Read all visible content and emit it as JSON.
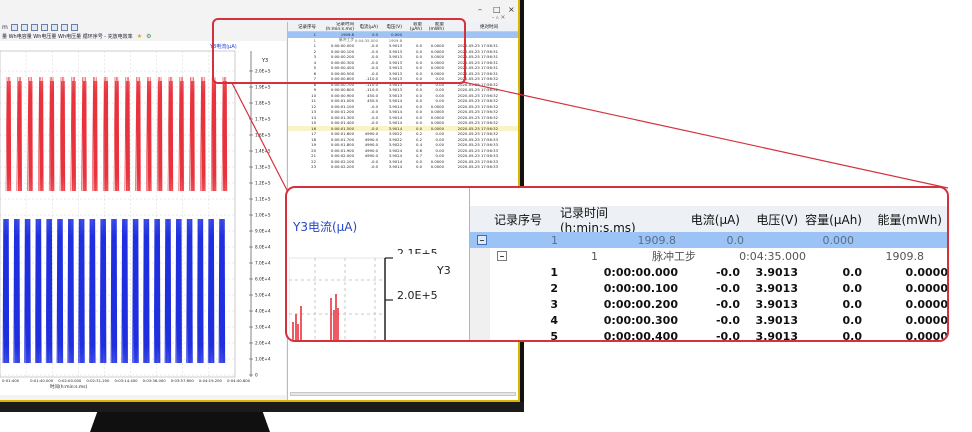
{
  "window": {
    "minimize": "–",
    "maximize": "□",
    "close": "×",
    "restore": "- ₀ ×"
  },
  "toolbar": {
    "buttons": [
      "folder-open",
      "save",
      "chart",
      "table",
      "zoom",
      "export"
    ],
    "row2_text": "量 Wh电容量 Wh电压量 Wh电压量   循环序号 - 充放电效率",
    "star_icon": "★",
    "gear_icon": "⚙"
  },
  "chart": {
    "y_title": "Y3电流(μA)",
    "y_label": "Y3",
    "x_title": "时间(h:min:s.ms)",
    "y_ticks": [
      "2.0E+5",
      "1.9E+5",
      "1.8E+5",
      "1.7E+5",
      "1.6E+5",
      "1.4E+5",
      "1.3E+5",
      "1.2E+5",
      "1.1E+5",
      "1.0E+5",
      "9.0E+4",
      "8.0E+4",
      "7.0E+4",
      "6.0E+4",
      "5.0E+4",
      "4.0E+4",
      "3.0E+4",
      "2.0E+4",
      "1.0E+4",
      "0"
    ],
    "x_ticks": [
      "0:01:400",
      "0:01:40.000",
      "0:02:00.000",
      "0:02:31.200",
      "0:03:14.400",
      "0:03:36.000",
      "0:03:57.600",
      "0:04:19.200",
      "0:04:40.800"
    ],
    "red_color": "#e8323c",
    "blue_color": "#1f2fe0"
  },
  "table": {
    "headers": [
      "记录序号",
      "记录时间(h:min:s.ms)",
      "电流(μA)",
      "电压(V)",
      "容量(μAh)",
      "能量(mWh)",
      "绝对时间"
    ],
    "summary_row": [
      "1",
      "1909.8",
      "0.0",
      "0.000",
      ""
    ],
    "step_row": [
      "1",
      "脉冲工步",
      "0:04:35.000",
      "1909.8"
    ],
    "rows": [
      [
        "1",
        "0:00:00.000",
        "-0.0",
        "3.9013",
        "0.0",
        "0.0000",
        "2020-05-25 17:56:31"
      ],
      [
        "2",
        "0:00:00.100",
        "-0.0",
        "3.9013",
        "0.0",
        "0.0000",
        "2020-05-25 17:56:31"
      ],
      [
        "3",
        "0:00:00.200",
        "-0.0",
        "3.9013",
        "0.0",
        "0.0000",
        "2020-05-25 17:56:31"
      ],
      [
        "4",
        "0:00:00.300",
        "-0.0",
        "3.9013",
        "0.0",
        "0.0000",
        "2020-05-25 17:56:31"
      ],
      [
        "5",
        "0:00:00.400",
        "-0.0",
        "3.9013",
        "0.0",
        "0.0000",
        "2020-05-25 17:56:31"
      ],
      [
        "6",
        "0:00:00.500",
        "-0.0",
        "3.9013",
        "0.0",
        "0.0000",
        "2020-05-25 17:56:31"
      ],
      [
        "7",
        "0:00:00.600",
        "-110.0",
        "3.9013",
        "0.0",
        "0.00",
        "2020-05-25 17:56:32"
      ],
      [
        "8",
        "0:00:00.700",
        "-110.0",
        "3.9013",
        "0.0",
        "0.00",
        "2020-05-25 17:56:32"
      ],
      [
        "9",
        "0:00:00.800",
        "-110.0",
        "3.9013",
        "0.0",
        "0.00",
        "2020-05-25 17:56:32"
      ],
      [
        "10",
        "0:00:00.900",
        "450.0",
        "3.9013",
        "0.0",
        "0.00",
        "2020-05-25 17:56:32"
      ],
      [
        "11",
        "0:00:01.000",
        "450.0",
        "3.9014",
        "0.0",
        "0.00",
        "2020-05-25 17:56:32"
      ],
      [
        "12",
        "0:00:01.100",
        "-0.0",
        "3.9014",
        "0.0",
        "0.0000",
        "2020-05-25 17:56:32"
      ],
      [
        "13",
        "0:00:01.200",
        "-0.0",
        "3.9014",
        "0.0",
        "0.0000",
        "2020-05-25 17:56:32"
      ],
      [
        "14",
        "0:00:01.300",
        "-0.0",
        "3.9014",
        "0.0",
        "0.0000",
        "2020-05-25 17:56:32"
      ],
      [
        "15",
        "0:00:01.400",
        "-0.0",
        "3.9014",
        "0.0",
        "0.0000",
        "2020-05-25 17:56:32"
      ],
      [
        "16",
        "0:00:01.500",
        "-0.0",
        "3.9014",
        "0.0",
        "0.0000",
        "2020-05-25 17:56:32"
      ],
      [
        "17",
        "0:00:01.600",
        "4990.0",
        "3.9022",
        "0.2",
        "0.00",
        "2020-05-25 17:56:32"
      ],
      [
        "18",
        "0:00:01.700",
        "4990.0",
        "3.9022",
        "0.2",
        "0.00",
        "2020-05-25 17:56:33"
      ],
      [
        "19",
        "0:00:01.800",
        "4990.0",
        "3.9022",
        "0.4",
        "0.00",
        "2020-05-25 17:56:33"
      ],
      [
        "20",
        "0:00:01.900",
        "4990.0",
        "3.9024",
        "0.6",
        "0.00",
        "2020-05-25 17:56:33"
      ],
      [
        "21",
        "0:00:02.000",
        "4990.0",
        "3.9024",
        "0.7",
        "0.00",
        "2020-05-25 17:56:33"
      ],
      [
        "22",
        "0:00:02.100",
        "-0.0",
        "3.9014",
        "0.0",
        "0.0000",
        "2020-05-25 17:56:33"
      ],
      [
        "23",
        "0:00:02.200",
        "-0.0",
        "3.9014",
        "0.0",
        "0.0000",
        "2020-05-25 17:56:33"
      ]
    ],
    "bottom_rows": [
      [
        "51",
        "0:00:05.000",
        "35000.0",
        "3.9088",
        "10.4",
        "0.04",
        "2020-05-25 17:56:36"
      ],
      [
        "52",
        "0:00:05.100",
        "-0.0",
        "3.9020",
        "0.0",
        "0.0000",
        "2020-05-25 17:56:36"
      ],
      [
        "53",
        "0:00:05.200",
        "-0.0",
        "3.9020",
        "0.0",
        "0.0000",
        "2020-05-25 17:56:36"
      ],
      [
        "54",
        "0:00:05.300",
        "-0.0",
        "3.9020",
        "0.0",
        "0.0000",
        "2020-05-25 17:56:36"
      ],
      [
        "55",
        "0:00:05.400",
        "-0.0",
        "3.9018",
        "0.0",
        "0.0000",
        "2020-05-25 17:56:37"
      ],
      [
        "56",
        "0:00:05.500",
        "-0.0",
        "3.9018",
        "0.0",
        "0.0000",
        "2020-05-25 17:56:37"
      ],
      [
        "57",
        "0:00:05.600",
        "49990.0",
        "3.9109",
        "11.5",
        "0.05",
        "2020-05-25 17:56:37"
      ]
    ]
  },
  "zoom": {
    "y_title": "Y3电流(μA)",
    "y_label": "Y3",
    "tick_top": "2.1E+5",
    "tick": "2.0E+5",
    "headers": [
      "记录序号",
      "记录时间(h:min:s.ms)",
      "电流(μA)",
      "电压(V)",
      "容量(μAh)",
      "能量(mWh)"
    ],
    "summary": [
      "1",
      "1909.8",
      "0.0",
      "0.000"
    ],
    "step": [
      "1",
      "脉冲工步",
      "0:04:35.000",
      "1909.8"
    ],
    "rows": [
      [
        "1",
        "0:00:00.000",
        "-0.0",
        "3.9013",
        "0.0",
        "0.0000"
      ],
      [
        "2",
        "0:00:00.100",
        "-0.0",
        "3.9013",
        "0.0",
        "0.0000"
      ],
      [
        "3",
        "0:00:00.200",
        "-0.0",
        "3.9013",
        "0.0",
        "0.0000"
      ],
      [
        "4",
        "0:00:00.300",
        "-0.0",
        "3.9013",
        "0.0",
        "0.0000"
      ],
      [
        "5",
        "0:00:00.400",
        "-0.0",
        "3.9013",
        "0.0",
        "0.0000"
      ]
    ]
  },
  "colors": {
    "callout": "#d4313d",
    "row_highlight": "#9cc3f5",
    "accent_blue": "#2846c8"
  }
}
